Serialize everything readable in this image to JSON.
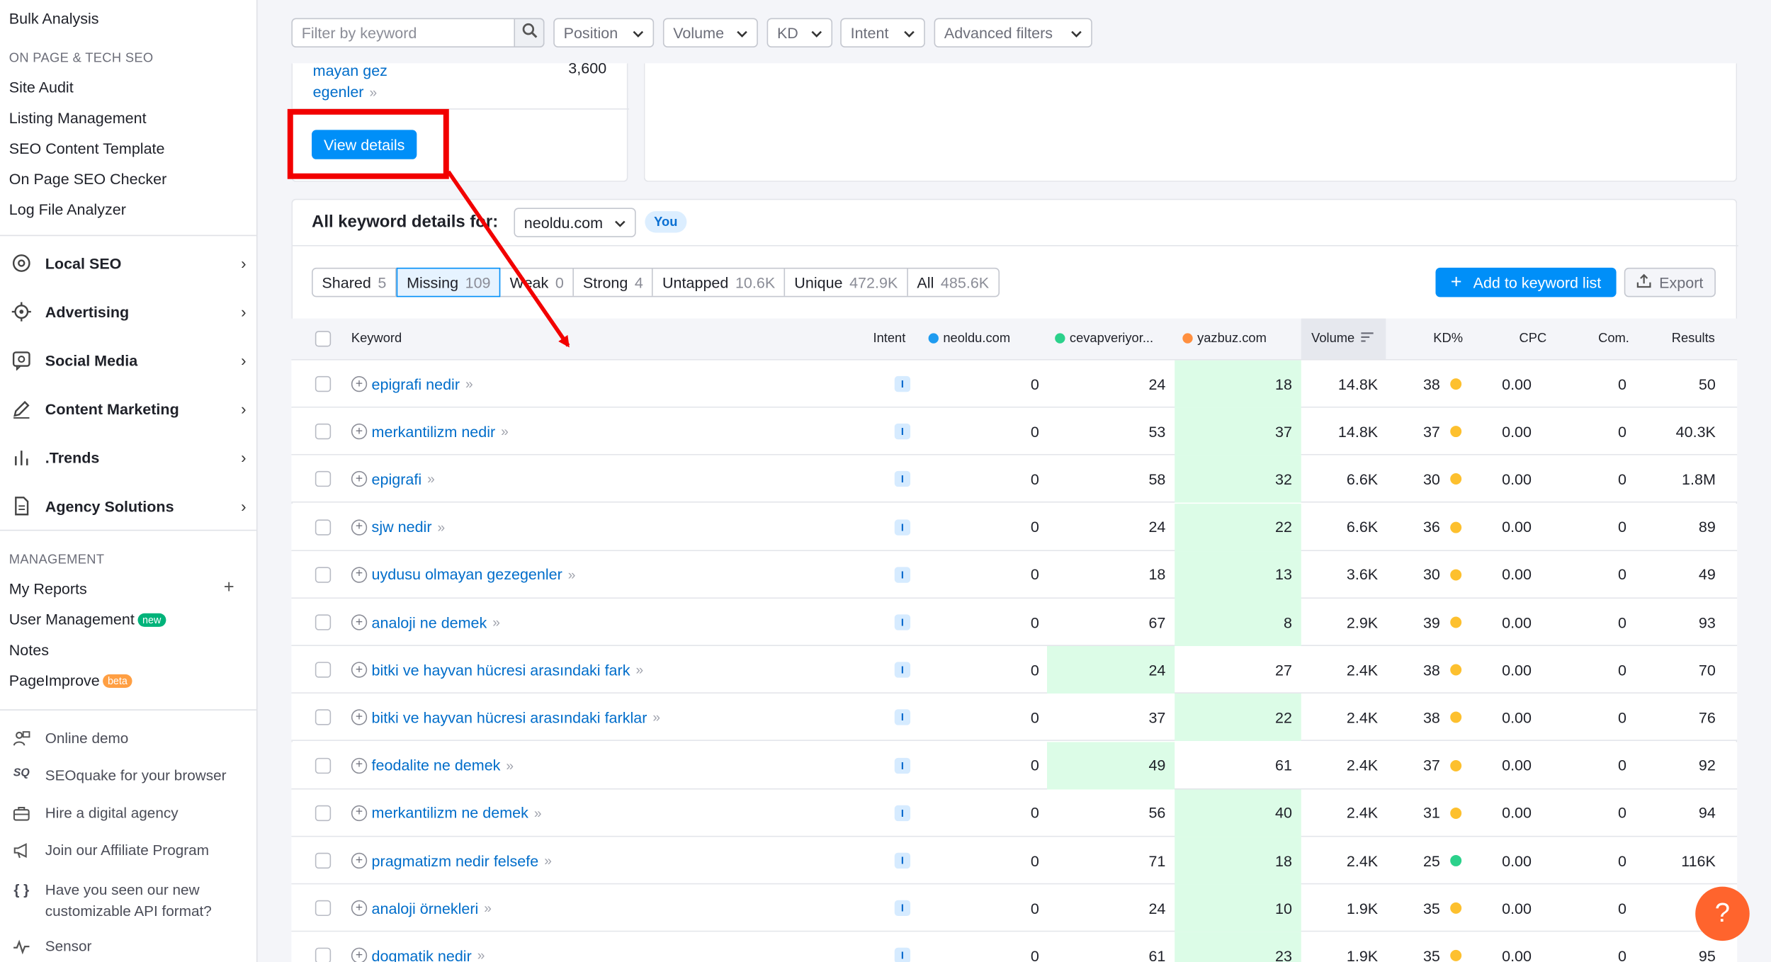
{
  "sidebar": {
    "top_link": "Bulk Analysis",
    "section_onpage": "ON PAGE & TECH SEO",
    "onpage_items": [
      "Site Audit",
      "Listing Management",
      "SEO Content Template",
      "On Page SEO Checker",
      "Log File Analyzer"
    ],
    "groups": [
      {
        "label": "Local SEO",
        "icon": "location-pin-icon"
      },
      {
        "label": "Advertising",
        "icon": "target-icon"
      },
      {
        "label": "Social Media",
        "icon": "social-chat-icon"
      },
      {
        "label": "Content Marketing",
        "icon": "pencil-icon"
      },
      {
        "label": ".Trends",
        "icon": "bar-chart-icon"
      },
      {
        "label": "Agency Solutions",
        "icon": "document-icon"
      }
    ],
    "section_management": "MANAGEMENT",
    "management_items": [
      {
        "label": "My Reports",
        "badge": ""
      },
      {
        "label": "User Management",
        "badge": "new"
      },
      {
        "label": "Notes",
        "badge": ""
      },
      {
        "label": "PageImprove",
        "badge": "beta"
      }
    ],
    "extras": [
      {
        "label": "Online demo",
        "icon": "presenter-icon"
      },
      {
        "label": "SEOquake for your browser",
        "icon": "seoquake-icon"
      },
      {
        "label": "Hire a digital agency",
        "icon": "briefcase-icon"
      },
      {
        "label": "Join our Affiliate Program",
        "icon": "megaphone-icon"
      },
      {
        "label": "Have you seen our new customizable API format?",
        "icon": "braces-icon"
      },
      {
        "label": "Sensor",
        "icon": "pulse-icon"
      }
    ]
  },
  "filters": {
    "keyword_placeholder": "Filter by keyword",
    "position": "Position",
    "volume": "Volume",
    "kd": "KD",
    "intent": "Intent",
    "advanced": "Advanced filters"
  },
  "top_card": {
    "keyword_line1": "mayan gez",
    "keyword_line2": "egenler",
    "volume": "3,600",
    "view_details": "View details"
  },
  "details": {
    "title": "All keyword details for:",
    "domain": "neoldu.com",
    "you_badge": "You",
    "add_to_list": "Add to keyword list",
    "export": "Export"
  },
  "tabs": [
    {
      "label": "Shared",
      "count": "5"
    },
    {
      "label": "Missing",
      "count": "109"
    },
    {
      "label": "Weak",
      "count": "0"
    },
    {
      "label": "Strong",
      "count": "4"
    },
    {
      "label": "Untapped",
      "count": "10.6K"
    },
    {
      "label": "Unique",
      "count": "472.9K"
    },
    {
      "label": "All",
      "count": "485.6K"
    }
  ],
  "columns": {
    "keyword": "Keyword",
    "intent": "Intent",
    "d1": "neoldu.com",
    "d2": "cevapveriyor...",
    "d3": "yazbuz.com",
    "volume": "Volume",
    "kd": "KD%",
    "cpc": "CPC",
    "com": "Com.",
    "results": "Results"
  },
  "colors": {
    "d1": "#1e9bf0",
    "d2": "#2bd18b",
    "d3": "#ff8f3f",
    "kd_yellow": "#fdc02e",
    "kd_green": "#2bd18b",
    "highlight": "#dcfce7",
    "accent": "#008ff8"
  },
  "rows": [
    {
      "keyword": "epigrafi nedir",
      "intent": "I",
      "d1": "0",
      "d2": "24",
      "d3": "18",
      "best": "d3",
      "volume": "14.8K",
      "kd": "38",
      "kd_color": "yellow",
      "cpc": "0.00",
      "com": "0",
      "results": "50"
    },
    {
      "keyword": "merkantilizm nedir",
      "intent": "I",
      "d1": "0",
      "d2": "53",
      "d3": "37",
      "best": "d3",
      "volume": "14.8K",
      "kd": "37",
      "kd_color": "yellow",
      "cpc": "0.00",
      "com": "0",
      "results": "40.3K"
    },
    {
      "keyword": "epigrafi",
      "intent": "I",
      "d1": "0",
      "d2": "58",
      "d3": "32",
      "best": "d3",
      "volume": "6.6K",
      "kd": "30",
      "kd_color": "yellow",
      "cpc": "0.00",
      "com": "0",
      "results": "1.8M"
    },
    {
      "keyword": "sjw nedir",
      "intent": "I",
      "d1": "0",
      "d2": "24",
      "d3": "22",
      "best": "d3",
      "volume": "6.6K",
      "kd": "36",
      "kd_color": "yellow",
      "cpc": "0.00",
      "com": "0",
      "results": "89"
    },
    {
      "keyword": "uydusu olmayan gezegenler",
      "intent": "I",
      "d1": "0",
      "d2": "18",
      "d3": "13",
      "best": "d3",
      "volume": "3.6K",
      "kd": "30",
      "kd_color": "yellow",
      "cpc": "0.00",
      "com": "0",
      "results": "49"
    },
    {
      "keyword": "analoji ne demek",
      "intent": "I",
      "d1": "0",
      "d2": "67",
      "d3": "8",
      "best": "d3",
      "volume": "2.9K",
      "kd": "39",
      "kd_color": "yellow",
      "cpc": "0.00",
      "com": "0",
      "results": "93"
    },
    {
      "keyword": "bitki ve hayvan hücresi arasındaki fark",
      "intent": "I",
      "d1": "0",
      "d2": "24",
      "d3": "27",
      "best": "d2",
      "volume": "2.4K",
      "kd": "38",
      "kd_color": "yellow",
      "cpc": "0.00",
      "com": "0",
      "results": "70"
    },
    {
      "keyword": "bitki ve hayvan hücresi arasındaki farklar",
      "intent": "I",
      "d1": "0",
      "d2": "37",
      "d3": "22",
      "best": "d3",
      "volume": "2.4K",
      "kd": "38",
      "kd_color": "yellow",
      "cpc": "0.00",
      "com": "0",
      "results": "76"
    },
    {
      "keyword": "feodalite ne demek",
      "intent": "I",
      "d1": "0",
      "d2": "49",
      "d3": "61",
      "best": "d2",
      "volume": "2.4K",
      "kd": "37",
      "kd_color": "yellow",
      "cpc": "0.00",
      "com": "0",
      "results": "92"
    },
    {
      "keyword": "merkantilizm ne demek",
      "intent": "I",
      "d1": "0",
      "d2": "56",
      "d3": "40",
      "best": "d3",
      "volume": "2.4K",
      "kd": "31",
      "kd_color": "yellow",
      "cpc": "0.00",
      "com": "0",
      "results": "94"
    },
    {
      "keyword": "pragmatizm nedir felsefe",
      "intent": "I",
      "d1": "0",
      "d2": "71",
      "d3": "18",
      "best": "d3",
      "volume": "2.4K",
      "kd": "25",
      "kd_color": "green",
      "cpc": "0.00",
      "com": "0",
      "results": "116K"
    },
    {
      "keyword": "analoji örnekleri",
      "intent": "I",
      "d1": "0",
      "d2": "24",
      "d3": "10",
      "best": "d3",
      "volume": "1.9K",
      "kd": "35",
      "kd_color": "yellow",
      "cpc": "0.00",
      "com": "0",
      "results": ""
    },
    {
      "keyword": "dogmatik nedir",
      "intent": "I",
      "d1": "0",
      "d2": "61",
      "d3": "23",
      "best": "d3",
      "volume": "1.9K",
      "kd": "35",
      "kd_color": "yellow",
      "cpc": "0.00",
      "com": "0",
      "results": "95"
    }
  ],
  "help_label": "?"
}
